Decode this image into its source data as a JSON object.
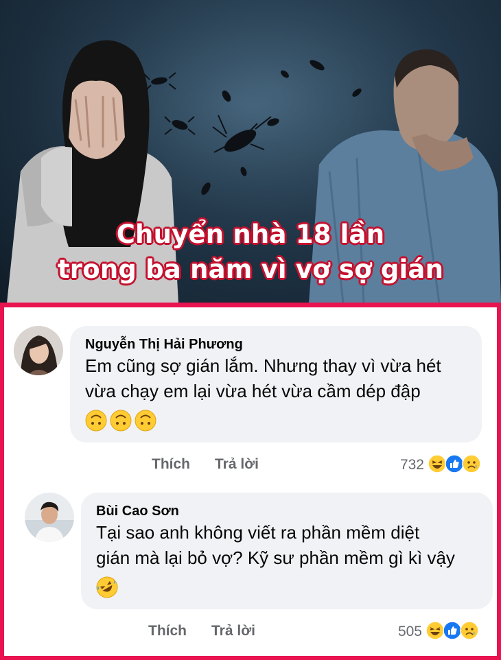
{
  "headline": {
    "line1": "Chuyển nhà 18 lần",
    "line2": "trong ba năm vì vợ sợ gián"
  },
  "comments": [
    {
      "author": "Nguyễn Thị Hải Phương",
      "lines": [
        "Em cũng sợ gián lắm. Nhưng thay vì vừa hét",
        "vừa chạy em lại vừa hét vừa cầm dép đập"
      ],
      "emojis": [
        "upside-down-face-icon",
        "upside-down-face-icon",
        "upside-down-face-icon"
      ],
      "like_label": "Thích",
      "reply_label": "Trả lời",
      "reaction_count": "732",
      "reactions": [
        "haha-icon",
        "like-icon",
        "sad-icon"
      ]
    },
    {
      "author": "Bùi Cao Sơn",
      "lines": [
        "Tại sao anh không viết ra phần mềm diệt",
        "gián mà lại bỏ vợ? Kỹ sư phần mềm gì kì vậy"
      ],
      "emojis": [
        "rolling-on-floor-laughing-icon"
      ],
      "like_label": "Thích",
      "reply_label": "Trả lời",
      "reaction_count": "505",
      "reactions": [
        "haha-icon",
        "like-icon",
        "sad-icon"
      ]
    }
  ],
  "colors": {
    "frame_border": "#e8134f",
    "headline_outline": "#c4122f",
    "bubble_bg": "#f0f2f5",
    "meta_text": "#65676b",
    "like_blue": "#1877f2"
  }
}
